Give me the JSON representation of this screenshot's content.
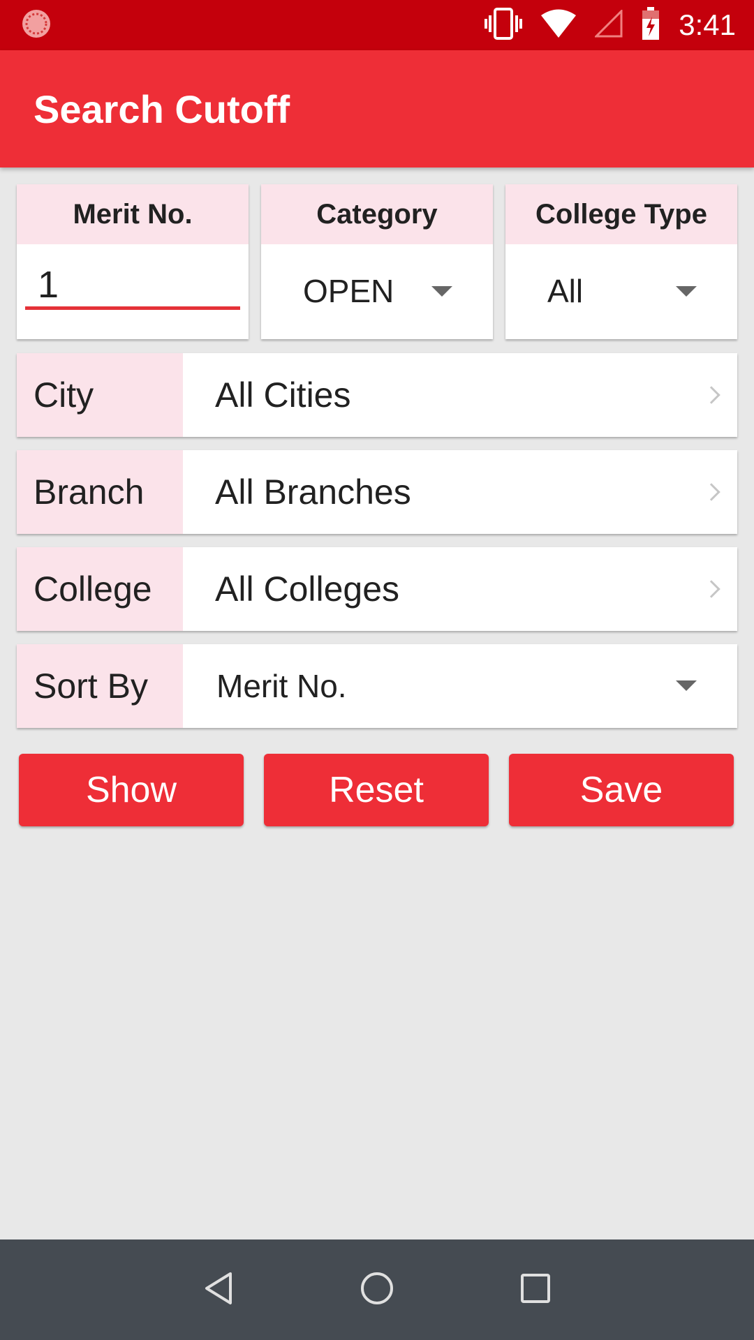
{
  "status_bar": {
    "time": "3:41",
    "icons": [
      "app-notification-icon",
      "vibrate-icon",
      "wifi-icon",
      "cell-signal-icon",
      "battery-charging-icon"
    ]
  },
  "app_bar": {
    "title": "Search Cutoff"
  },
  "filters": {
    "merit_no": {
      "label": "Merit No.",
      "value": "1"
    },
    "category": {
      "label": "Category",
      "selected": "OPEN"
    },
    "college_type": {
      "label": "College Type",
      "selected": "All"
    }
  },
  "rows": {
    "city": {
      "label": "City",
      "value": "All Cities"
    },
    "branch": {
      "label": "Branch",
      "value": "All Branches"
    },
    "college": {
      "label": "College",
      "value": "All Colleges"
    },
    "sort_by": {
      "label": "Sort By",
      "selected": "Merit No."
    }
  },
  "buttons": {
    "show": "Show",
    "reset": "Reset",
    "save": "Save"
  },
  "colors": {
    "status_bar": "#c4000c",
    "accent": "#ee2e37",
    "label_bg": "#fbe3ea",
    "background": "#e8e8e8",
    "nav_bar": "#454b52"
  }
}
